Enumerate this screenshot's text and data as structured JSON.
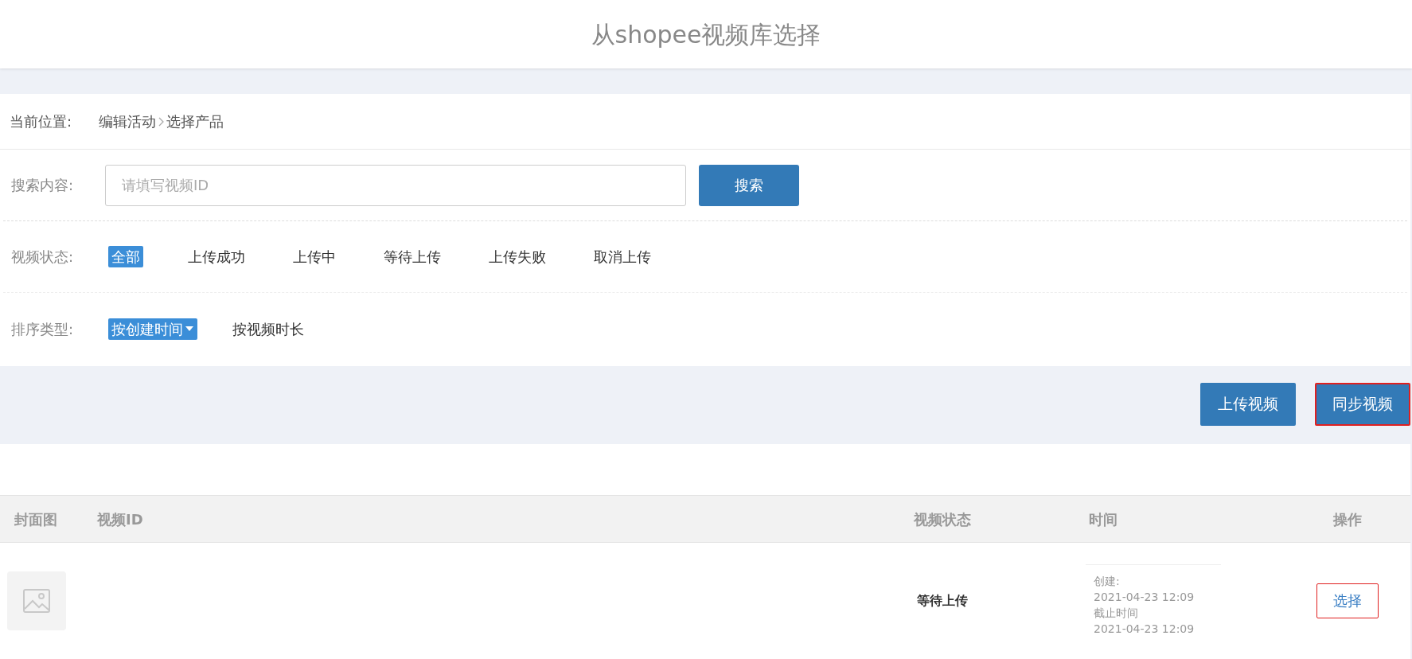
{
  "dialog": {
    "title": "从shopee视频库选择"
  },
  "breadcrumb": {
    "label": "当前位置:",
    "items": [
      "编辑活动",
      "选择产品"
    ]
  },
  "search": {
    "label": "搜索内容:",
    "placeholder": "请填写视频ID",
    "button": "搜索"
  },
  "status_filter": {
    "label": "视频状态:",
    "options": [
      {
        "label": "全部",
        "selected": true
      },
      {
        "label": "上传成功",
        "selected": false
      },
      {
        "label": "上传中",
        "selected": false
      },
      {
        "label": "等待上传",
        "selected": false
      },
      {
        "label": "上传失败",
        "selected": false
      },
      {
        "label": "取消上传",
        "selected": false
      }
    ]
  },
  "sort": {
    "label": "排序类型:",
    "options": [
      {
        "label": "按创建时间",
        "selected": true
      },
      {
        "label": "按视频时长",
        "selected": false
      }
    ]
  },
  "actions": [
    {
      "label": "上传视频",
      "highlighted": false
    },
    {
      "label": "同步视频",
      "highlighted": true
    }
  ],
  "table": {
    "columns": [
      "封面图",
      "视频ID",
      "视频状态",
      "时间",
      "操作"
    ],
    "rows": [
      {
        "video_id": "",
        "status": "等待上传",
        "created_label": "创建:",
        "created": "2021-04-23 12:09",
        "deadline_label": "截止时间",
        "deadline": "2021-04-23 12:09",
        "action": {
          "label": "选择",
          "highlighted": true
        }
      }
    ]
  }
}
